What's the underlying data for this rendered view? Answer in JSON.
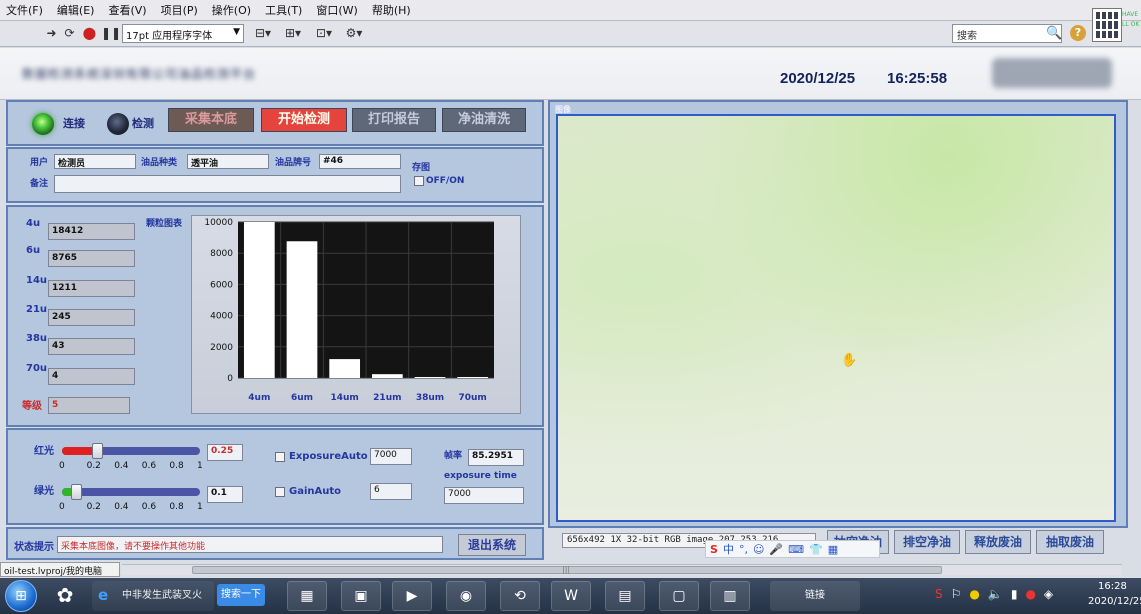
{
  "menu": [
    "文件(F)",
    "编辑(E)",
    "查看(V)",
    "项目(P)",
    "操作(O)",
    "工具(T)",
    "窗口(W)",
    "帮助(H)"
  ],
  "toolbar": {
    "font": "17pt 应用程序字体",
    "search_placeholder": "搜索",
    "help_label": "?"
  },
  "logo_side_text": [
    "HAVE",
    "LL OK"
  ],
  "header": {
    "company": "数据检测系统深圳有限公司油品检测平台",
    "date": "2020/12/25",
    "time": "16:25:58"
  },
  "controls": {
    "connect_label": "连接",
    "detect_label": "检测",
    "collect_bg": "采集本底",
    "start": "开始检测",
    "print": "打印报告",
    "clean": "净油清洗"
  },
  "form": {
    "user_label": "用户",
    "user_value": "检测员",
    "oil_type_label": "油品种类",
    "oil_type_value": "透平油",
    "oil_grade_label": "油品牌号",
    "oil_grade_value": "#46",
    "save_label": "存图",
    "save_toggle": "OFF/ON",
    "note_label": "备注",
    "note_value": ""
  },
  "counts": [
    {
      "label": "4u",
      "value": "18412"
    },
    {
      "label": "6u",
      "value": "8765"
    },
    {
      "label": "14u",
      "value": "1211"
    },
    {
      "label": "21u",
      "value": "245"
    },
    {
      "label": "38u",
      "value": "43"
    },
    {
      "label": "70u",
      "value": "4"
    }
  ],
  "grade": {
    "label": "等级",
    "value": "5"
  },
  "chart_title": "颗粒图表",
  "chart_data": {
    "type": "bar",
    "categories": [
      "4um",
      "6um",
      "14um",
      "21um",
      "38um",
      "70um"
    ],
    "values": [
      10000,
      8765,
      1211,
      245,
      43,
      4
    ],
    "ylim": [
      0,
      10000
    ],
    "yticks": [
      0,
      2000,
      4000,
      6000,
      8000,
      10000
    ],
    "grid": true,
    "bar_color": "#ffffff",
    "background": "#141414"
  },
  "lights": {
    "red_label": "红光",
    "red_value": "0.25",
    "red_level": 0.25,
    "green_label": "绿光",
    "green_value": "0.1",
    "green_level": 0.1,
    "ticks": [
      "0",
      "0.2",
      "0.4",
      "0.6",
      "0.8",
      "1"
    ]
  },
  "camera": {
    "exposure_auto_label": "ExposureAuto",
    "exposure_value": "7000",
    "gain_auto_label": "GainAuto",
    "gain_value": "6",
    "rate_label": "帧率",
    "rate_value": "85.2951",
    "exposure_time_label": "exposure time",
    "exposure_time_value": "7000"
  },
  "status": {
    "label": "状态提示",
    "message": "采集本底图像，请不要操作其他功能",
    "exit": "退出系统"
  },
  "image_panel": {
    "title": "图像",
    "info": "656x492 1X 32-bit RGB image 207,253,216",
    "buttons": [
      "抽空净油",
      "排空净油",
      "释放废油",
      "抽取废油"
    ]
  },
  "ime": {
    "logo": "S",
    "mode": "中"
  },
  "project_path": "oil-test.lvproj/我的电脑",
  "taskbar": {
    "ie_title": "中非发生武装叉火",
    "search": "搜索一下",
    "link": "链接",
    "time": "16:28",
    "date": "2020/12/25"
  },
  "colors": {
    "panel": "#b5c6df",
    "panel_border": "#5f7fb5",
    "label_blue": "#2436a0",
    "start_red": "#e5433d",
    "status_red": "#cc2a2a",
    "red_slider": "#e02020",
    "green_slider": "#32b32a"
  }
}
